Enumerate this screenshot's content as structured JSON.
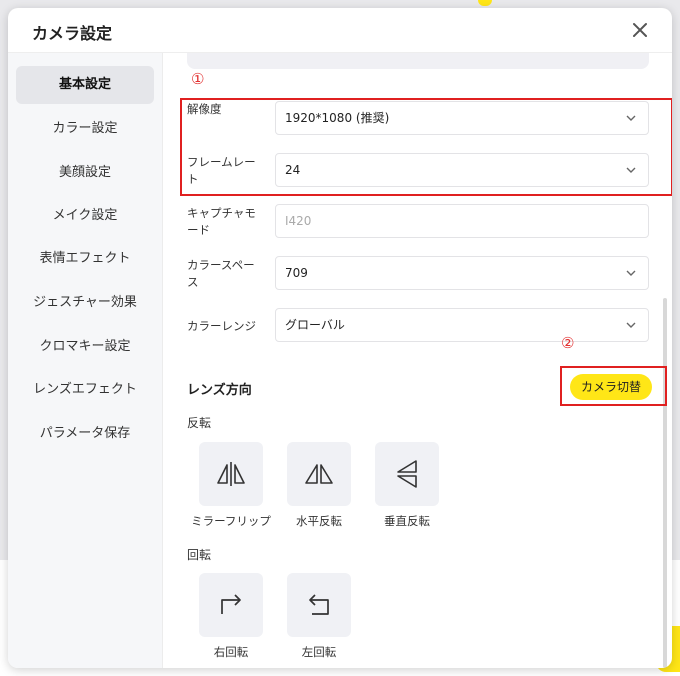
{
  "dialog": {
    "title": "カメラ設定"
  },
  "sidebar": {
    "items": [
      {
        "label": "基本設定",
        "active": true
      },
      {
        "label": "カラー設定"
      },
      {
        "label": "美顔設定"
      },
      {
        "label": "メイク設定"
      },
      {
        "label": "表情エフェクト"
      },
      {
        "label": "ジェスチャー効果"
      },
      {
        "label": "クロマキー設定"
      },
      {
        "label": "レンズエフェクト"
      },
      {
        "label": "パラメータ保存"
      }
    ]
  },
  "settings": {
    "resolution": {
      "label": "解像度",
      "value": "1920*1080 (推奨)"
    },
    "framerate": {
      "label": "フレームレート",
      "value": "24"
    },
    "capture_mode": {
      "label": "キャプチャモード",
      "value": "I420"
    },
    "color_space": {
      "label": "カラースペース",
      "value": "709"
    },
    "color_range": {
      "label": "カラーレンジ",
      "value": "グローバル"
    }
  },
  "annotations": {
    "marker1": "①",
    "marker2": "②"
  },
  "lens": {
    "title": "レンズ方向",
    "switch_label": "カメラ切替",
    "flip_label": "反転",
    "flip_tiles": [
      "ミラーフリップ",
      "水平反転",
      "垂直反転"
    ],
    "rotate_label": "回転",
    "rotate_tiles": [
      "右回転",
      "左回転"
    ]
  },
  "colors": {
    "accent_yellow": "#ffe617",
    "annotation_red": "#e02020"
  },
  "icons": [
    "close-icon",
    "chevron-down-icon",
    "mirror-flip-icon",
    "horizontal-flip-icon",
    "vertical-flip-icon",
    "rotate-right-icon",
    "rotate-left-icon"
  ]
}
